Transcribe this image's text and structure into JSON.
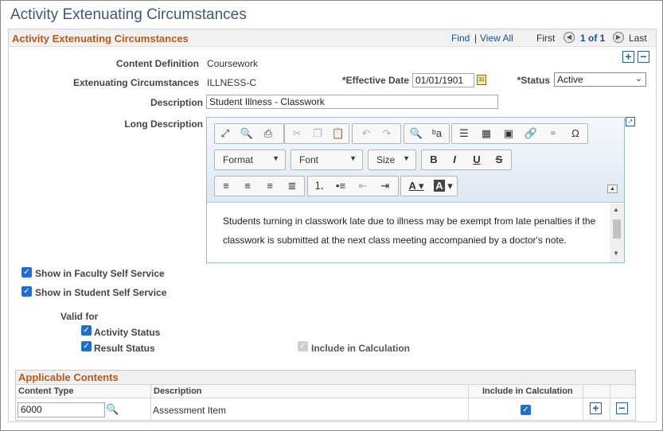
{
  "page": {
    "title": "Activity Extenuating Circumstances"
  },
  "group": {
    "title": "Activity Extenuating Circumstances",
    "nav": {
      "find": "Find",
      "sep": "|",
      "view_all": "View All",
      "first": "First",
      "position": "1 of 1",
      "last": "Last"
    },
    "add_label": "+",
    "remove_label": "−"
  },
  "fields": {
    "content_definition": {
      "label": "Content Definition",
      "value": "Coursework"
    },
    "extenuating": {
      "label": "Extenuating Circumstances",
      "value": "ILLNESS-C"
    },
    "effective_date": {
      "label": "*Effective Date",
      "value": "01/01/1901",
      "cal_icon": "31"
    },
    "status": {
      "label": "*Status",
      "value": "Active"
    },
    "description": {
      "label": "Description",
      "value": "Student Illness - Classwork"
    },
    "long_description": {
      "label": "Long Description",
      "text": "Students turning in classwork late due to illness may be exempt from late penalties if the classwork is submitted at the next class meeting accompanied by a doctor's note."
    }
  },
  "editor": {
    "row1_icons": [
      "maximize-icon",
      "preview-icon",
      "print-icon",
      "cut-icon",
      "copy-icon",
      "paste-icon",
      "undo-icon",
      "redo-icon",
      "find-icon",
      "replace-icon",
      "horizontal-line-icon",
      "table-icon",
      "image-icon",
      "link-icon",
      "unlink-icon",
      "special-char-icon"
    ],
    "format_label": "Format",
    "font_label": "Font",
    "size_label": "Size",
    "bold_label": "B",
    "italic_label": "I",
    "underline_label": "U",
    "strike_label": "S",
    "text_color_label": "A",
    "bg_color_label": "A"
  },
  "checkboxes": {
    "faculty": {
      "label": "Show in Faculty Self Service",
      "checked": true
    },
    "student": {
      "label": "Show in Student Self Service",
      "checked": true
    },
    "valid_for": "Valid for",
    "activity_status": {
      "label": "Activity Status",
      "checked": true
    },
    "result_status": {
      "label": "Result Status",
      "checked": true
    },
    "include_calc": {
      "label": "Include in Calculation",
      "checked": true,
      "disabled": true
    }
  },
  "grid": {
    "title": "Applicable Contents",
    "columns": [
      "Content Type",
      "Description",
      "Include in Calculation"
    ],
    "rows": [
      {
        "content_type": "6000",
        "description": "Assessment Item",
        "include": true
      }
    ]
  },
  "colors": {
    "title": "#3d5a7a",
    "group_title": "#b35a1f",
    "link": "#1a4f8b",
    "check": "#1f6fd1"
  }
}
